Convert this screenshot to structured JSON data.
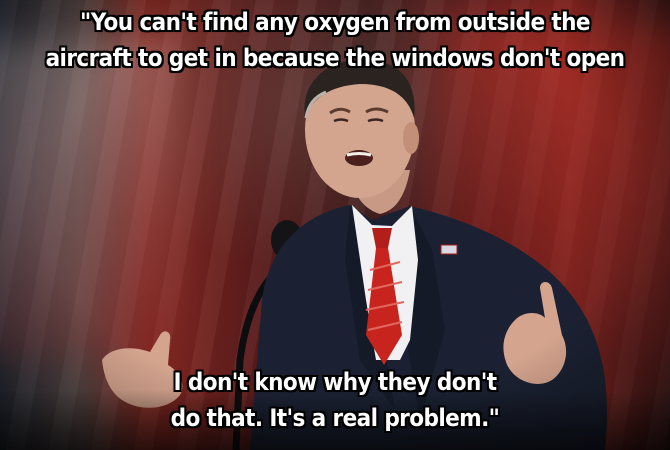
{
  "caption": {
    "top_lines": [
      "\"You can't find any oxygen from outside the",
      "aircraft to get in because the windows don't open"
    ],
    "bottom_lines": [
      "I don't know why they don't",
      "do that. It's a real problem.\""
    ]
  },
  "colors": {
    "caption_text": "#ffffff",
    "caption_outline": "#000000",
    "backdrop_red": "#8a2a22",
    "suit": "#1c2233",
    "tie": "#c8241e"
  }
}
